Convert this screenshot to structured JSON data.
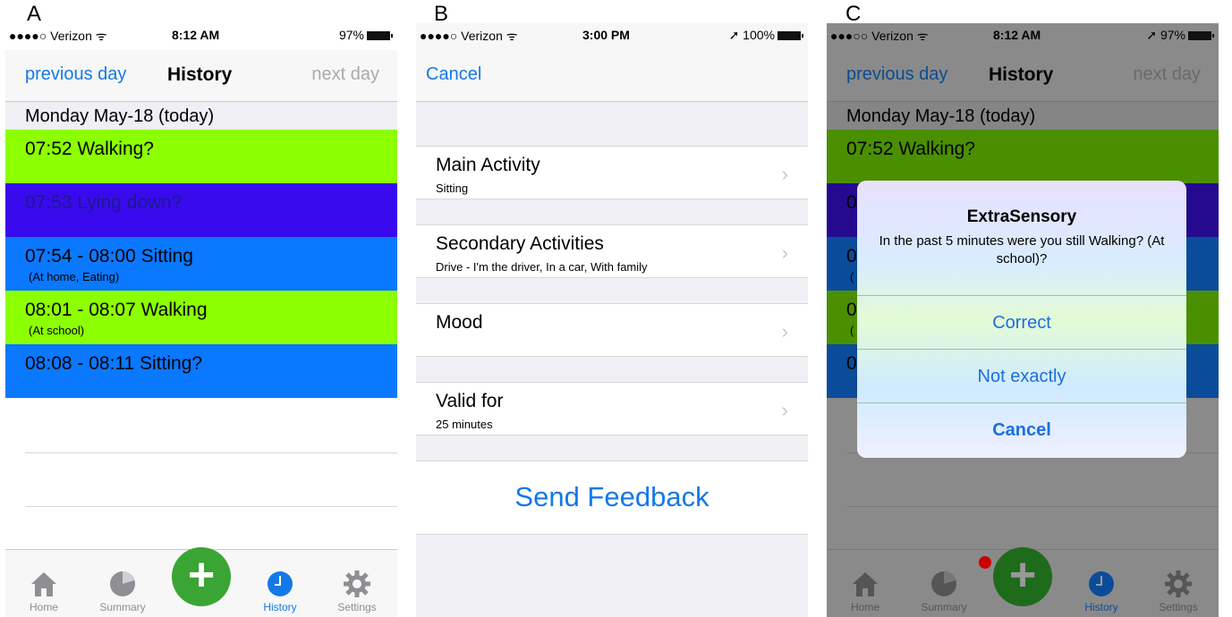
{
  "panels": {
    "a": {
      "letter": "A"
    },
    "b": {
      "letter": "B"
    },
    "c": {
      "letter": "C"
    }
  },
  "history": {
    "status": {
      "carrier": "●●●●○ Verizon ᯤ",
      "time": "8:12 AM",
      "battery": "97%"
    },
    "nav": {
      "left": "previous day",
      "title": "History",
      "right": "next day"
    },
    "day_header": "Monday May-18 (today)",
    "rows": [
      {
        "main": "07:52   Walking?",
        "sub": "",
        "color": "#8cff00",
        "text_color": "#000000"
      },
      {
        "main": "07:53   Lying down?",
        "sub": "",
        "color": "#3a0aee",
        "text_color": "#1a1a8a"
      },
      {
        "main": "07:54 - 08:00   Sitting",
        "sub": "(At home, Eating)",
        "color": "#0a78ff",
        "text_color": "#000000"
      },
      {
        "main": "08:01 - 08:07   Walking",
        "sub": "(At school)",
        "color": "#8cff00",
        "text_color": "#000000"
      },
      {
        "main": "08:08 - 08:11   Sitting?",
        "sub": "",
        "color": "#0a78ff",
        "text_color": "#000000"
      }
    ],
    "tabs": {
      "home": "Home",
      "summary": "Summary",
      "history": "History",
      "settings": "Settings",
      "plus": "+"
    }
  },
  "feedback": {
    "status": {
      "carrier": "●●●●○ Verizon ᯤ",
      "time": "3:00 PM",
      "battery": "➚ 100%"
    },
    "cancel": "Cancel",
    "cells": [
      {
        "title": "Main Activity",
        "sub": "Sitting"
      },
      {
        "title": "Secondary Activities",
        "sub": "Drive - I'm the driver, In a car, With family"
      },
      {
        "title": "Mood",
        "sub": ""
      },
      {
        "title": "Valid for",
        "sub": "25 minutes"
      }
    ],
    "send": "Send Feedback"
  },
  "alert_screen": {
    "status": {
      "carrier": "●●●○○ Verizon ᯤ",
      "time": "8:12 AM",
      "battery": "➚ 97%"
    },
    "nav": {
      "left": "previous day",
      "title": "History",
      "right": "next day"
    },
    "day_header": "Monday May-18 (today)",
    "first_row": "07:52   Walking?",
    "partial_glyphs": [
      "0",
      "0",
      "0",
      "0"
    ],
    "partial_sub": [
      "(",
      "("
    ],
    "dialog": {
      "title": "ExtraSensory",
      "message": "In the past 5 minutes were you still Walking? (At school)?",
      "correct": "Correct",
      "not_exactly": "Not exactly",
      "cancel": "Cancel"
    },
    "tabs": {
      "home": "Home",
      "summary": "Summary",
      "history": "History",
      "settings": "Settings",
      "plus": "+"
    }
  }
}
